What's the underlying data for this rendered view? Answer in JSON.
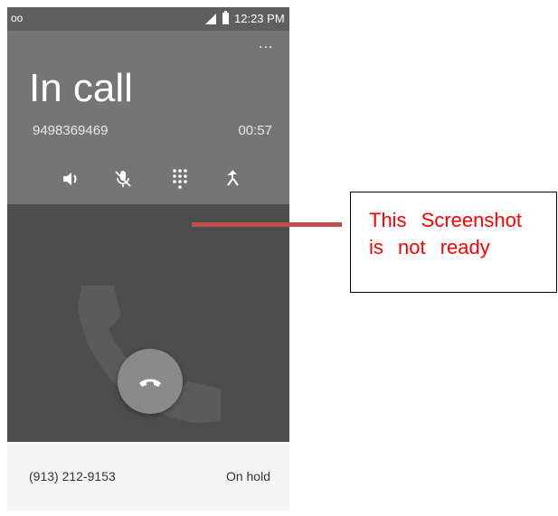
{
  "status_bar": {
    "voicemail_icon": "oo",
    "time": "12:23 PM"
  },
  "call": {
    "title": "In call",
    "number": "9498369469",
    "duration": "00:57",
    "more_icon": "..."
  },
  "controls": [
    "speaker-icon",
    "mute-icon",
    "dialpad-icon",
    "merge-call-icon"
  ],
  "on_hold": {
    "number": "(913) 212-9153",
    "status": "On hold"
  },
  "annotation": {
    "text": "This Screenshot is not ready"
  },
  "colors": {
    "status_bar": "#5f5f5f",
    "header": "#757575",
    "body": "#4d4d4d",
    "end_button": "#8a8a8a",
    "annotation_text": "#ff0000",
    "annotation_line": "#c0504d"
  }
}
